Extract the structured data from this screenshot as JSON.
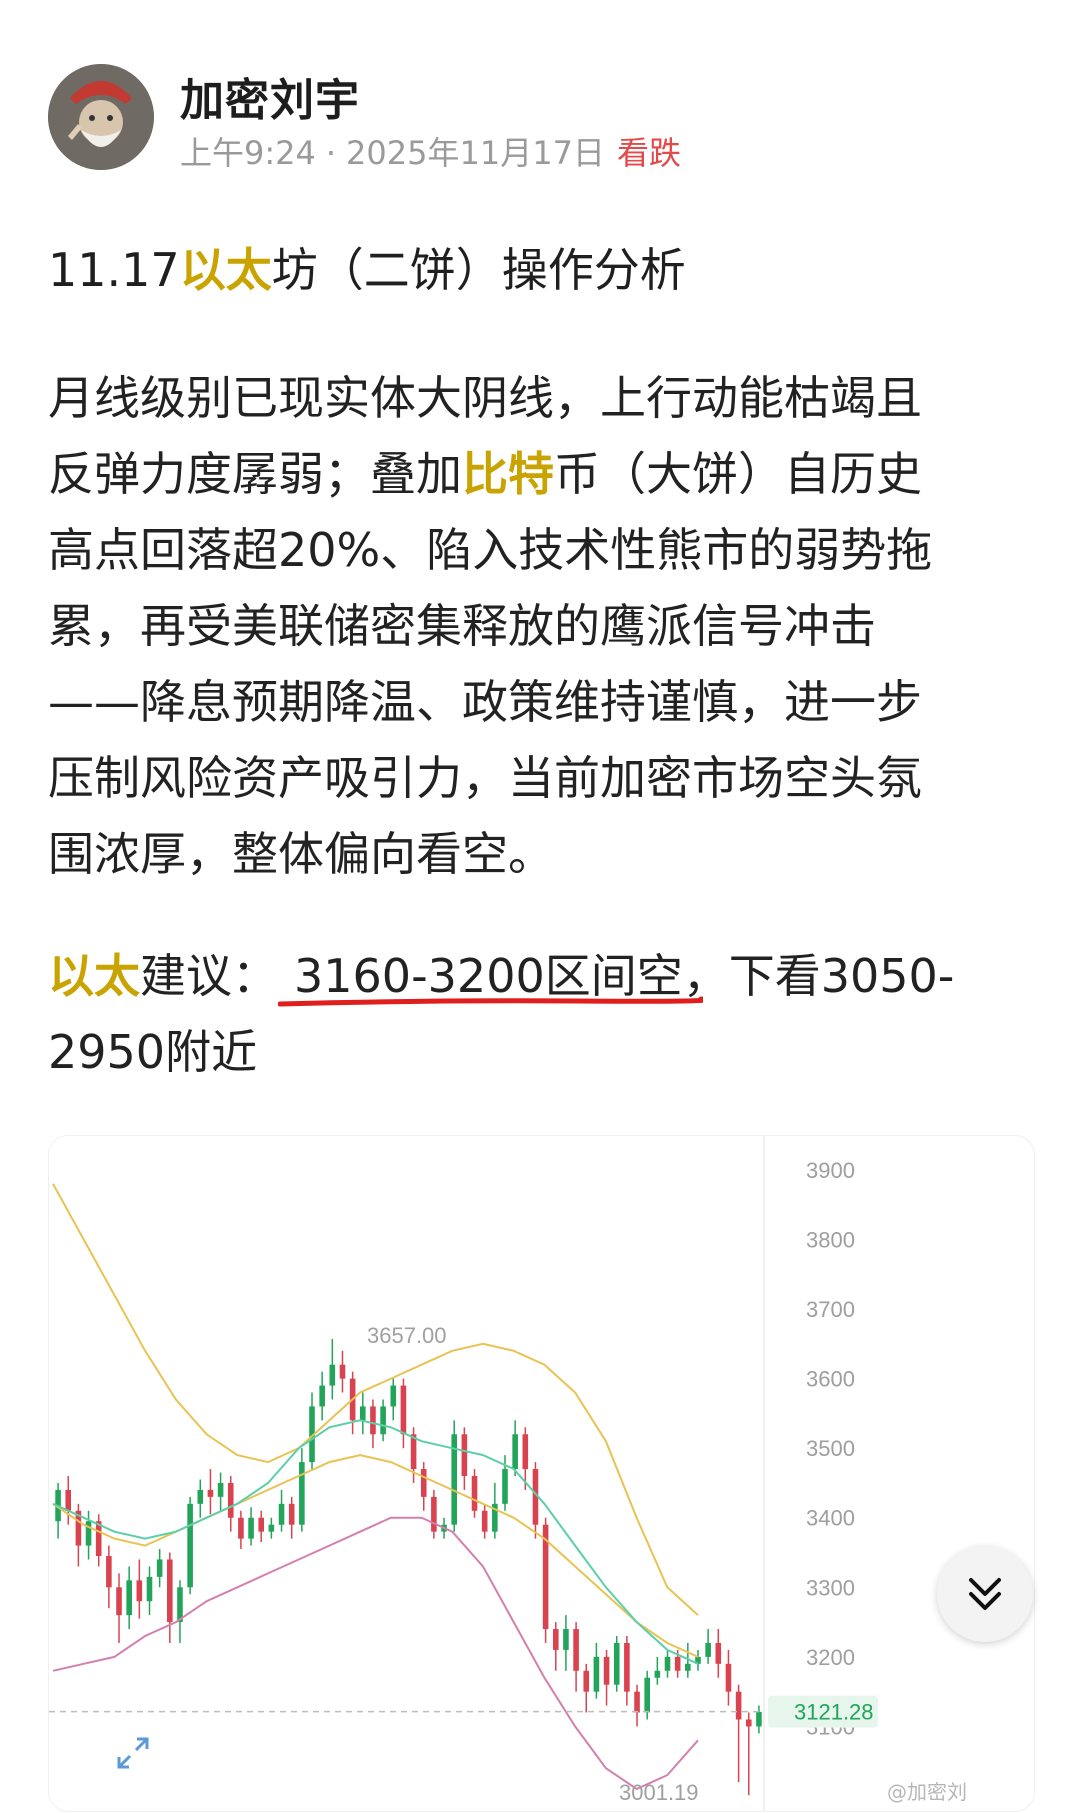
{
  "post": {
    "author_name": "加密刘宇",
    "time": "上午9:24",
    "date": "2025年11月17日",
    "sentiment": "看跌",
    "title": {
      "prefix": "11.17",
      "highlight": "以太",
      "suffix": "坊（二饼）操作分析"
    },
    "body_lines": [
      "月线级别已现实体大阴线，上行动能枯竭且",
      {
        "before": "反弹力度孱弱；叠加",
        "highlight": "比特",
        "after": "币（大饼）自历史"
      },
      "高点回落超20%、陷入技术性熊市的弱势拖",
      "累，再受美联储密集释放的鹰派信号冲击",
      "——降息预期降温、政策维持谨慎，进一步",
      "压制风险资产吸引力，当前加密市场空头氛",
      "围浓厚，整体偏向看空。"
    ],
    "advice": {
      "label": "以太",
      "label_suffix": "建议：",
      "range": "3160-3200区间空",
      "rest_line1": "，下看3050-",
      "line2": "2950附近"
    }
  },
  "chart_data": {
    "type": "candlestick",
    "y_ticks": [
      "3900",
      "3800",
      "3700",
      "3600",
      "3500",
      "3400",
      "3300",
      "3200",
      "3100"
    ],
    "ylim": [
      3000,
      3920
    ],
    "high_label": "3657.00",
    "low_label": "3001.19",
    "last_price": "3121.28",
    "watermark": "@加密刘",
    "colors": {
      "up": "#22a45a",
      "down": "#d9434f",
      "upper_band": "#e8c352",
      "lower_band": "#d47fae",
      "middle": "#5bcfa8",
      "last_line": "#bdbdbd",
      "last_tag": "#22a45a"
    },
    "candles": [
      [
        3395,
        3440,
        3370,
        3450
      ],
      [
        3440,
        3410,
        3390,
        3460
      ],
      [
        3410,
        3360,
        3330,
        3420
      ],
      [
        3360,
        3395,
        3340,
        3410
      ],
      [
        3395,
        3345,
        3330,
        3405
      ],
      [
        3345,
        3300,
        3270,
        3360
      ],
      [
        3300,
        3260,
        3220,
        3320
      ],
      [
        3260,
        3310,
        3240,
        3330
      ],
      [
        3310,
        3280,
        3255,
        3340
      ],
      [
        3280,
        3315,
        3260,
        3330
      ],
      [
        3315,
        3340,
        3300,
        3355
      ],
      [
        3340,
        3250,
        3220,
        3350
      ],
      [
        3250,
        3300,
        3220,
        3310
      ],
      [
        3300,
        3420,
        3290,
        3430
      ],
      [
        3420,
        3440,
        3400,
        3455
      ],
      [
        3440,
        3430,
        3405,
        3470
      ],
      [
        3430,
        3450,
        3410,
        3465
      ],
      [
        3450,
        3400,
        3380,
        3460
      ],
      [
        3400,
        3370,
        3355,
        3410
      ],
      [
        3370,
        3400,
        3360,
        3415
      ],
      [
        3400,
        3380,
        3365,
        3410
      ],
      [
        3380,
        3390,
        3370,
        3400
      ],
      [
        3390,
        3420,
        3380,
        3440
      ],
      [
        3420,
        3390,
        3370,
        3430
      ],
      [
        3390,
        3480,
        3380,
        3500
      ],
      [
        3480,
        3560,
        3470,
        3580
      ],
      [
        3560,
        3590,
        3540,
        3610
      ],
      [
        3590,
        3620,
        3570,
        3657
      ],
      [
        3620,
        3600,
        3580,
        3640
      ],
      [
        3600,
        3540,
        3520,
        3610
      ],
      [
        3540,
        3560,
        3520,
        3580
      ],
      [
        3560,
        3520,
        3500,
        3570
      ],
      [
        3520,
        3560,
        3510,
        3570
      ],
      [
        3560,
        3590,
        3540,
        3600
      ],
      [
        3590,
        3520,
        3500,
        3600
      ],
      [
        3520,
        3470,
        3450,
        3530
      ],
      [
        3470,
        3430,
        3410,
        3480
      ],
      [
        3430,
        3380,
        3370,
        3440
      ],
      [
        3380,
        3390,
        3370,
        3400
      ],
      [
        3390,
        3520,
        3380,
        3540
      ],
      [
        3520,
        3460,
        3440,
        3530
      ],
      [
        3460,
        3410,
        3400,
        3470
      ],
      [
        3410,
        3380,
        3370,
        3420
      ],
      [
        3380,
        3420,
        3370,
        3450
      ],
      [
        3420,
        3470,
        3410,
        3490
      ],
      [
        3470,
        3520,
        3460,
        3540
      ],
      [
        3520,
        3470,
        3440,
        3530
      ],
      [
        3470,
        3390,
        3370,
        3480
      ],
      [
        3390,
        3240,
        3220,
        3400
      ],
      [
        3240,
        3210,
        3180,
        3250
      ],
      [
        3210,
        3240,
        3180,
        3260
      ],
      [
        3240,
        3180,
        3150,
        3250
      ],
      [
        3180,
        3150,
        3120,
        3190
      ],
      [
        3150,
        3200,
        3140,
        3220
      ],
      [
        3200,
        3160,
        3130,
        3210
      ],
      [
        3160,
        3220,
        3150,
        3230
      ],
      [
        3220,
        3150,
        3130,
        3230
      ],
      [
        3150,
        3120,
        3100,
        3160
      ],
      [
        3120,
        3170,
        3110,
        3180
      ],
      [
        3170,
        3180,
        3160,
        3200
      ],
      [
        3180,
        3200,
        3170,
        3210
      ],
      [
        3200,
        3180,
        3170,
        3210
      ],
      [
        3180,
        3190,
        3170,
        3220
      ],
      [
        3190,
        3200,
        3180,
        3210
      ],
      [
        3200,
        3220,
        3190,
        3240
      ],
      [
        3220,
        3190,
        3170,
        3240
      ],
      [
        3190,
        3150,
        3130,
        3210
      ],
      [
        3150,
        3110,
        3020,
        3160
      ],
      [
        3110,
        3100,
        3001,
        3120
      ],
      [
        3100,
        3121,
        3090,
        3130
      ]
    ],
    "upper_band": [
      3880,
      3800,
      3720,
      3640,
      3570,
      3520,
      3490,
      3480,
      3500,
      3540,
      3580,
      3600,
      3620,
      3640,
      3650,
      3640,
      3620,
      3580,
      3510,
      3400,
      3300,
      3260
    ],
    "middle_band": [
      3420,
      3400,
      3380,
      3370,
      3380,
      3400,
      3420,
      3450,
      3500,
      3530,
      3540,
      3530,
      3510,
      3500,
      3490,
      3470,
      3420,
      3360,
      3300,
      3250,
      3210,
      3190
    ],
    "lower_band": [
      3180,
      3190,
      3200,
      3230,
      3250,
      3280,
      3300,
      3320,
      3340,
      3360,
      3380,
      3400,
      3400,
      3380,
      3330,
      3250,
      3170,
      3100,
      3040,
      3010,
      3030,
      3080
    ],
    "ma_yellow": [
      3420,
      3390,
      3370,
      3360,
      3380,
      3400,
      3420,
      3440,
      3460,
      3480,
      3490,
      3480,
      3460,
      3440,
      3420,
      3400,
      3370,
      3330,
      3290,
      3250,
      3220,
      3200
    ]
  },
  "icons": {
    "fab": "double-chevron-down-icon",
    "expand": "expand-arrows-icon"
  }
}
